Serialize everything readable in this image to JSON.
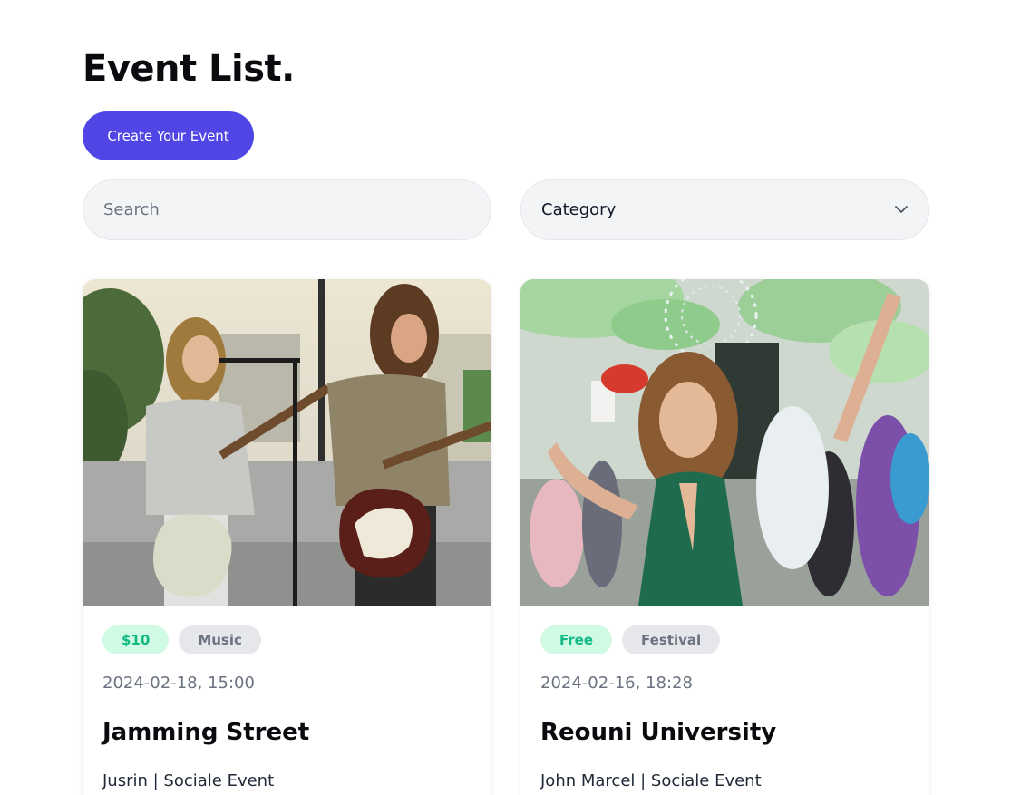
{
  "header": {
    "title": "Event List.",
    "create_button_label": "Create Your Event"
  },
  "filters": {
    "search_placeholder": "Search",
    "category_label": "Category"
  },
  "events": [
    {
      "price": "$10",
      "category": "Music",
      "datetime": "2024-02-18, 15:00",
      "title": "Jamming Street",
      "meta": "Jusrin | Sociale Event"
    },
    {
      "price": "Free",
      "category": "Festival",
      "datetime": "2024-02-16, 18:28",
      "title": "Reouni University",
      "meta": "John Marcel | Sociale Event"
    }
  ],
  "colors": {
    "accent": "#4f46e5",
    "price_badge_bg": "#d1fae5",
    "price_badge_text": "#10b981",
    "category_badge_bg": "#e5e7eb",
    "category_badge_text": "#6b7280"
  },
  "icons": {
    "category_dropdown": "chevron-down-icon"
  }
}
